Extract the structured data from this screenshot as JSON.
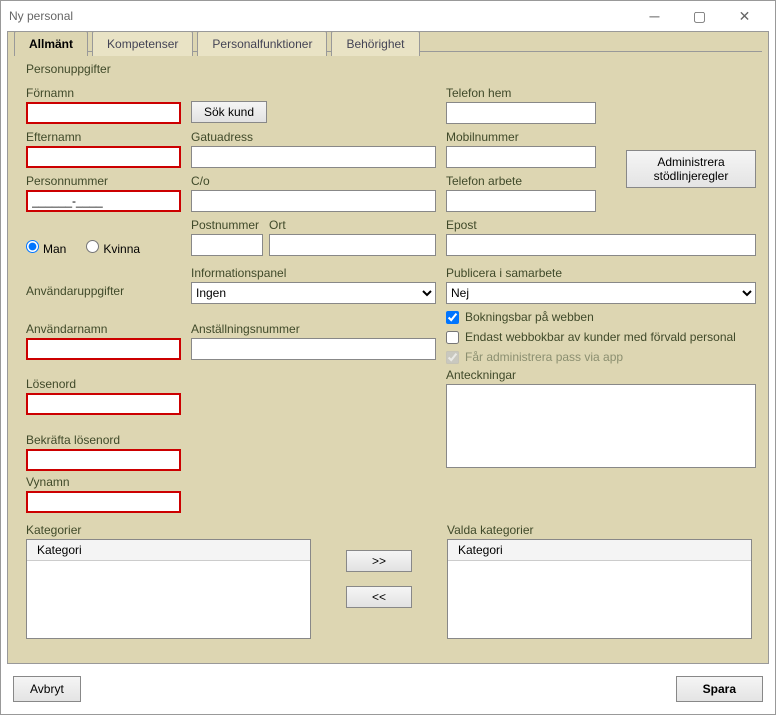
{
  "window": {
    "title": "Ny personal"
  },
  "tabs": [
    "Allmänt",
    "Kompetenser",
    "Personalfunktioner",
    "Behörighet"
  ],
  "active_tab": 0,
  "sections": {
    "person": "Personuppgifter",
    "user": "Användaruppgifter"
  },
  "labels": {
    "fornamn": "Förnamn",
    "efternamn": "Efternamn",
    "personnummer": "Personnummer",
    "man": "Man",
    "kvinna": "Kvinna",
    "gatuadress": "Gatuadress",
    "co": "C/o",
    "postnummer": "Postnummer",
    "ort": "Ort",
    "telefon_hem": "Telefon hem",
    "mobilnummer": "Mobilnummer",
    "telefon_arbete": "Telefon arbete",
    "epost": "Epost",
    "infopanel": "Informationspanel",
    "publicera": "Publicera i samarbete",
    "anstnr": "Anställningsnummer",
    "anvandarnamn": "Användarnamn",
    "losenord": "Lösenord",
    "bekrafta": "Bekräfta lösenord",
    "vynamn": "Vynamn",
    "kategorier": "Kategorier",
    "valda_kategorier": "Valda kategorier",
    "kategori_hdr": "Kategori",
    "anteckningar": "Anteckningar"
  },
  "values": {
    "personnummer": "______-____",
    "infopanel_selected": "Ingen",
    "publicera_selected": "Nej",
    "gender": "man",
    "bokningsbar": true,
    "endast_webbokbar": false,
    "far_administrera": true
  },
  "checkbox_labels": {
    "bokningsbar": "Bokningsbar på webben",
    "endast_webbokbar": "Endast webbokbar av kunder med förvald personal",
    "far_administrera": "Får administrera pass via app"
  },
  "buttons": {
    "sok_kund": "Sök kund",
    "admin_stod": "Administrera stödlinjeregler",
    "move_right": ">>",
    "move_left": "<<",
    "avbryt": "Avbryt",
    "spara": "Spara"
  }
}
